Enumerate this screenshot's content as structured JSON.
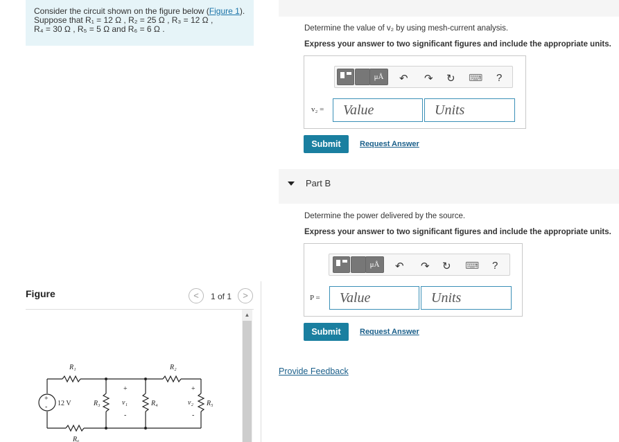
{
  "problem": {
    "line1_prefix": "Consider the circuit shown on the figure below (",
    "figure_link": "Figure 1",
    "line1_suffix": ").",
    "line2": "Suppose that R₁ = 12 Ω , R₂ = 25 Ω , R₃ = 12 Ω ,",
    "line3": "R₄ = 30 Ω , R₅ = 5 Ω and R₆ = 6 Ω ."
  },
  "figure": {
    "title": "Figure",
    "page_count": "1 of 1",
    "prev_glyph": "<",
    "next_glyph": ">",
    "scroll_up_glyph": "▲",
    "labels": {
      "r1": "R₁",
      "r2": "R₂",
      "r3": "R₃",
      "r4": "R₄",
      "r5": "R₅",
      "r6": "R₆",
      "source": "12 V",
      "v1": "v₁",
      "v2": "v₂",
      "plus": "+",
      "minus": "-"
    }
  },
  "part_a": {
    "prompt": "Determine the value of v₂ by using mesh-current analysis.",
    "instruction": "Express your answer to two significant figures and include the appropriate units.",
    "var_label": "v₂ =",
    "value_placeholder": "Value",
    "units_placeholder": "Units",
    "submit_label": "Submit",
    "request_label": "Request Answer"
  },
  "part_b": {
    "title": "Part B",
    "prompt": "Determine the power delivered by the source.",
    "instruction": "Express your answer to two significant figures and include the appropriate units.",
    "var_label": "P =",
    "value_placeholder": "Value",
    "units_placeholder": "Units",
    "submit_label": "Submit",
    "request_label": "Request Answer"
  },
  "toolbar": {
    "units_glyph": "μÅ",
    "undo_glyph": "↶",
    "redo_glyph": "↷",
    "reset_glyph": "↻",
    "keyboard_glyph": "⌨",
    "help_glyph": "?"
  },
  "feedback_label": "Provide Feedback"
}
